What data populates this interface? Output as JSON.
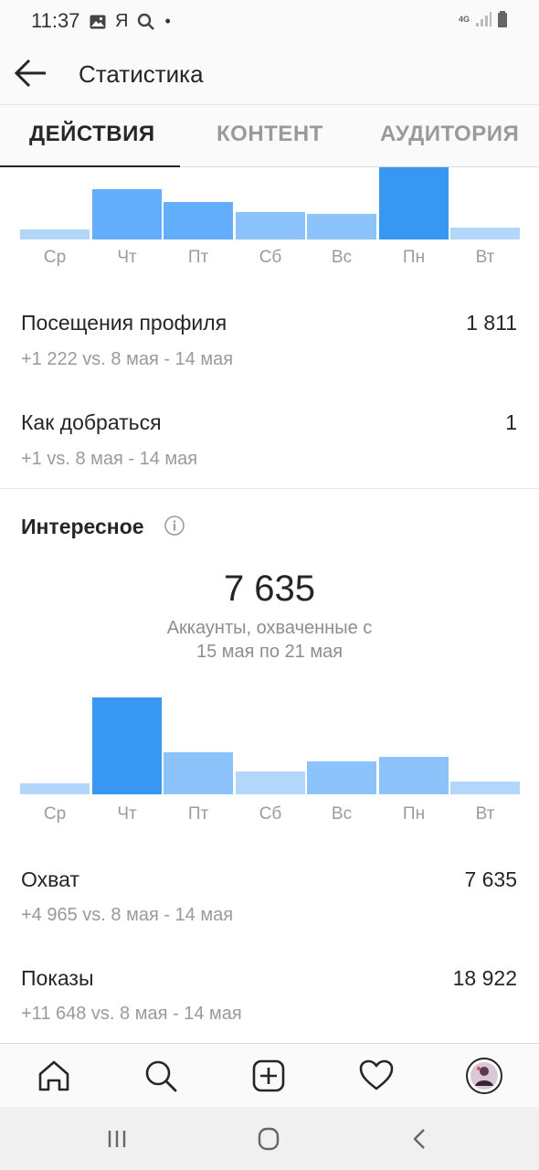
{
  "status_bar": {
    "time": "11:37",
    "carrier_glyph": "Я",
    "network": "4G"
  },
  "header": {
    "title": "Статистика"
  },
  "tabs": [
    {
      "label": "ДЕЙСТВИЯ",
      "active": true
    },
    {
      "label": "КОНТЕНТ",
      "active": false
    },
    {
      "label": "АУДИТОРИЯ",
      "active": false
    }
  ],
  "colors": {
    "bar_light": "#b3d7fb",
    "bar_mid": "#8cc3fa",
    "bar_strong": "#63aefa",
    "bar_max": "#3897f0",
    "text": "#262626",
    "muted": "#9a9a9a"
  },
  "chart_data": [
    {
      "type": "bar",
      "categories": [
        "Ср",
        "Чт",
        "Пт",
        "Сб",
        "Вс",
        "Пн",
        "Вт"
      ],
      "values": [
        11,
        56,
        42,
        30,
        28,
        80,
        13
      ],
      "ylim": [
        0,
        80
      ],
      "title": "",
      "xlabel": "",
      "ylabel": ""
    },
    {
      "type": "bar",
      "categories": [
        "Ср",
        "Чт",
        "Пт",
        "Сб",
        "Вс",
        "Пн",
        "Вт"
      ],
      "values": [
        11,
        99,
        43,
        23,
        34,
        38,
        13
      ],
      "ylim": [
        0,
        100
      ],
      "title": "",
      "xlabel": "",
      "ylabel": ""
    }
  ],
  "actions": {
    "profile_visits": {
      "label": "Посещения профиля",
      "value": "1 811",
      "delta": "+1 222 vs. 8 мая - 14 мая"
    },
    "directions": {
      "label": "Как добраться",
      "value": "1",
      "delta": "+1 vs. 8 мая - 14 мая"
    }
  },
  "discovery": {
    "title": "Интересное",
    "big_number": "7 635",
    "caption_line1": "Аккаунты, охваченные с",
    "caption_line2": "15 мая по 21 мая",
    "reach": {
      "label": "Охват",
      "value": "7 635",
      "delta": "+4 965 vs. 8 мая - 14 мая"
    },
    "impressions": {
      "label": "Показы",
      "value": "18 922",
      "delta": "+11 648 vs. 8 мая - 14 мая"
    }
  },
  "bottom_nav": [
    "home-icon",
    "search-icon",
    "new-post-icon",
    "activity-heart-icon",
    "profile-avatar"
  ]
}
